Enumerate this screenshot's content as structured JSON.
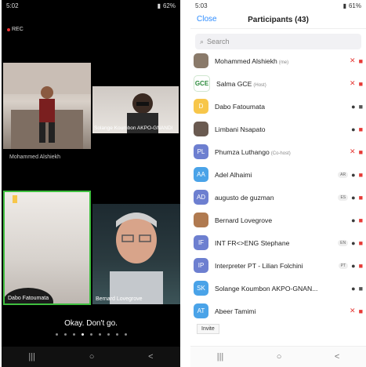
{
  "left": {
    "status_time": "5:02",
    "status_right": "62%",
    "rec_label": "REC",
    "tiles": [
      {
        "name": "Mohammed Alshiekh"
      },
      {
        "name": "Solange Koumbon AKPO-GNANDI"
      },
      {
        "name": "Dabo Fatoumata"
      },
      {
        "name": "Bernard Lovegrove"
      }
    ],
    "caption": "Okay. Don't go.",
    "nav": {
      "recent": "|||",
      "home": "○",
      "back": "<"
    }
  },
  "right": {
    "status_time": "5:03",
    "status_right": "61%",
    "close_label": "Close",
    "title": "Participants (43)",
    "search_placeholder": "Search",
    "participants": [
      {
        "initials": "",
        "name": "Mohammed Alshiekh",
        "tag": "(me)",
        "avatar_color": "#8a7a6a",
        "mic": "muted",
        "video": "off"
      },
      {
        "initials": "GCE",
        "name": "Salma GCE",
        "tag": "(Host)",
        "avatar_color": "#ffffff",
        "mic": "muted",
        "video": "off"
      },
      {
        "initials": "D",
        "name": "Dabo Fatoumata",
        "tag": "",
        "avatar_color": "#f7c64a",
        "mic": "on",
        "video": "on"
      },
      {
        "initials": "",
        "name": "Limbani Nsapato",
        "tag": "",
        "avatar_color": "#6a5a50",
        "mic": "on",
        "video": "off"
      },
      {
        "initials": "PL",
        "name": "Phumza Luthango",
        "tag": "(Co-host)",
        "avatar_color": "#6d7fd0",
        "mic": "muted",
        "video": "off"
      },
      {
        "initials": "AA",
        "name": "Adel Alhaimi",
        "tag": "",
        "avatar_color": "#4aa3e8",
        "badge": "AR",
        "mic": "on",
        "video": "off"
      },
      {
        "initials": "AD",
        "name": "augusto de guzman",
        "tag": "",
        "avatar_color": "#6d7fd0",
        "badge": "ES",
        "mic": "on",
        "video": "off"
      },
      {
        "initials": "",
        "name": "Bernard Lovegrove",
        "tag": "",
        "avatar_color": "#b07a50",
        "mic": "on",
        "video": "off"
      },
      {
        "initials": "IF",
        "name": "INT FR<>ENG Stephane",
        "tag": "",
        "avatar_color": "#6d7fd0",
        "badge": "EN",
        "mic": "on",
        "video": "off"
      },
      {
        "initials": "IP",
        "name": "Interpreter PT - Lilian Folchini",
        "tag": "",
        "avatar_color": "#6d7fd0",
        "badge": "PT",
        "mic": "on",
        "video": "off"
      },
      {
        "initials": "SK",
        "name": "Solange Koumbon AKPO-GNAN...",
        "tag": "",
        "avatar_color": "#4aa3e8",
        "mic": "on",
        "video": "on"
      },
      {
        "initials": "AT",
        "name": "Abeer Tamimi",
        "tag": "",
        "avatar_color": "#4aa3e8",
        "mic": "muted",
        "video": "off"
      }
    ],
    "invite_label": "Invite",
    "nav": {
      "recent": "|||",
      "home": "○",
      "back": "<"
    }
  },
  "colors": {
    "accent": "#2d8cff",
    "muted": "#e53935",
    "active_speaker": "#3fbf3f"
  }
}
